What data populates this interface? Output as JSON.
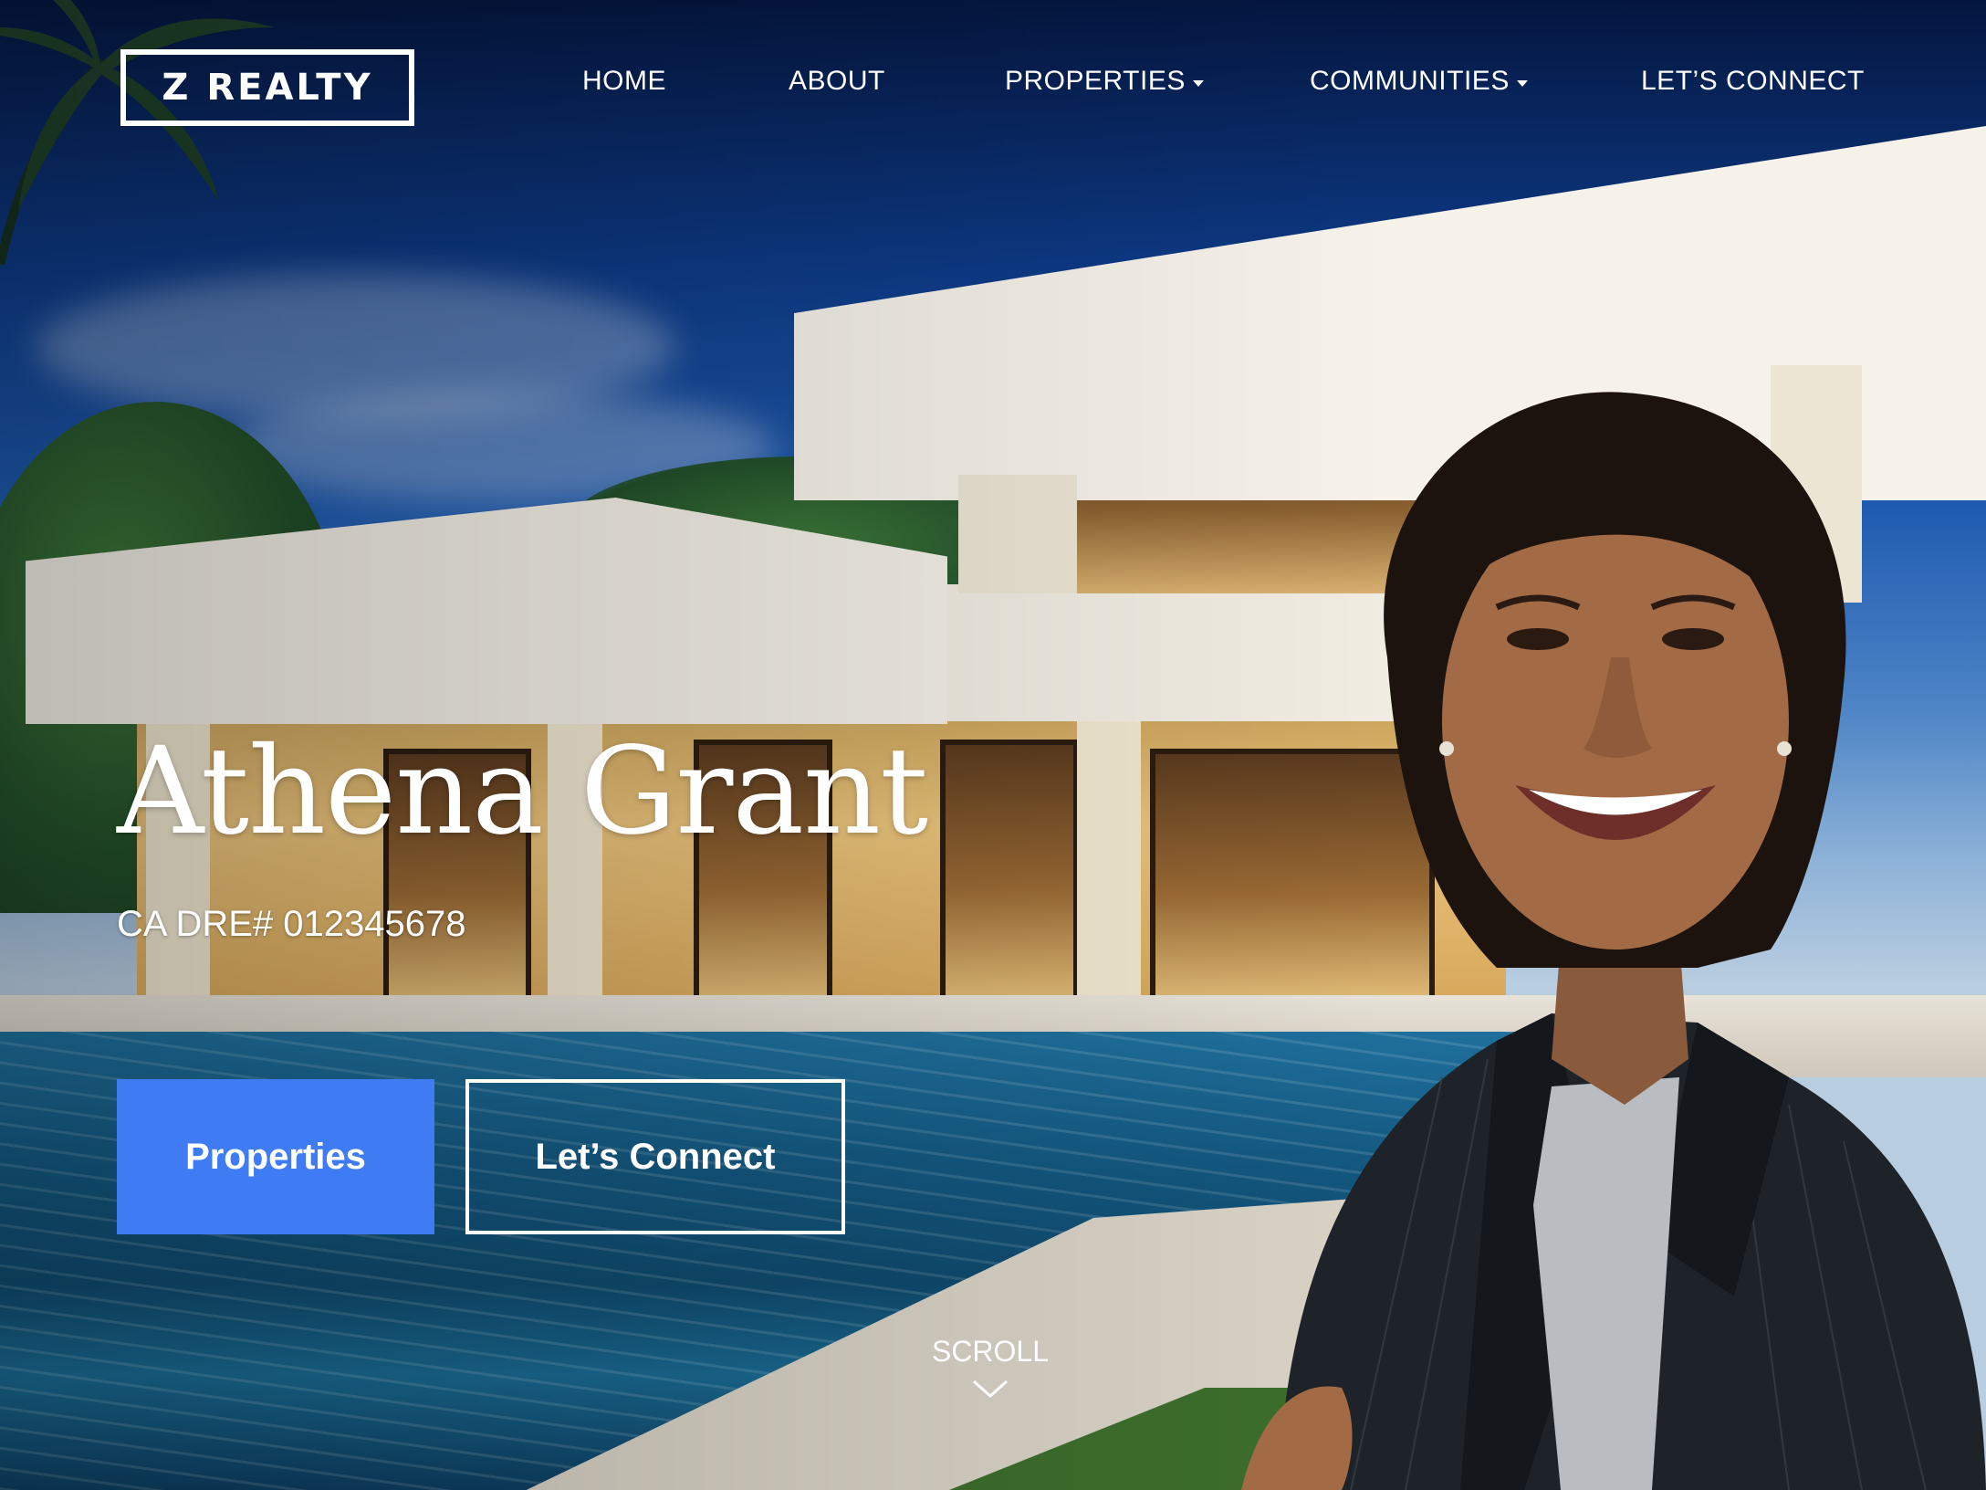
{
  "brand": {
    "logo_text": "Z REALTY"
  },
  "nav": {
    "items": [
      {
        "label": "HOME",
        "has_dropdown": false
      },
      {
        "label": "ABOUT",
        "has_dropdown": false
      },
      {
        "label": "PROPERTIES",
        "has_dropdown": true
      },
      {
        "label": "COMMUNITIES",
        "has_dropdown": true
      },
      {
        "label": "LET’S CONNECT",
        "has_dropdown": false
      }
    ]
  },
  "hero": {
    "name": "Athena Grant",
    "license": "CA DRE# 012345678",
    "primary_button": "Properties",
    "secondary_button": "Let’s Connect",
    "scroll_label": "SCROLL"
  },
  "colors": {
    "primary_button": "#3f7cf4",
    "text": "#ffffff",
    "sky": "#0d3a86"
  },
  "icons": {
    "caret": "chevron-down-icon",
    "scroll": "chevron-down-icon"
  }
}
